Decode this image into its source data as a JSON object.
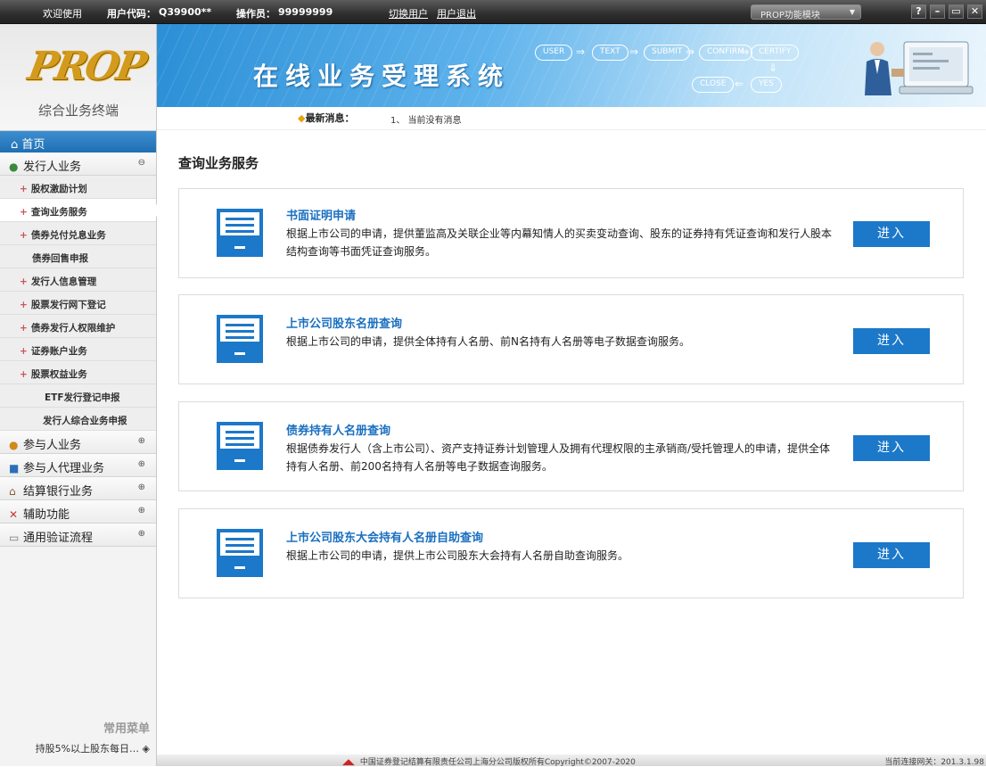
{
  "topbar": {
    "welcome": "欢迎使用",
    "user_code_label": "用户代码：",
    "user_code": "Q39900**",
    "operator_label": "操作员：",
    "operator": "99999999",
    "switch_user": "切换用户",
    "logout": "用户退出",
    "module": "PROP功能模块",
    "win_buttons": [
      "?",
      "–",
      "▭",
      "✕"
    ]
  },
  "sidebar": {
    "logo_word": "PROP",
    "logo_subtitle": "综合业务终端",
    "home": "首页",
    "sections": [
      {
        "label": "发行人业务",
        "icon": "person-icon",
        "toggle": "⊖",
        "expanded": true
      },
      {
        "label": "参与人业务",
        "icon": "people-icon",
        "toggle": "⊕"
      },
      {
        "label": "参与人代理业务",
        "icon": "monitor-icon",
        "toggle": "⊕"
      },
      {
        "label": "结算银行业务",
        "icon": "bank-icon",
        "toggle": "⊕"
      },
      {
        "label": "辅助功能",
        "icon": "tools-icon",
        "toggle": "⊕"
      },
      {
        "label": "通用验证流程",
        "icon": "briefcase-icon",
        "toggle": "⊕"
      }
    ],
    "sub_items": [
      {
        "label": "股权激励计划",
        "plus": true
      },
      {
        "label": "查询业务服务",
        "plus": true,
        "active": true
      },
      {
        "label": "债券兑付兑息业务",
        "plus": true
      },
      {
        "label": "债券回售申报",
        "plus": false
      },
      {
        "label": "发行人信息管理",
        "plus": true
      },
      {
        "label": "股票发行网下登记",
        "plus": true
      },
      {
        "label": "债券发行人权限维护",
        "plus": true
      },
      {
        "label": "证券账户业务",
        "plus": true
      },
      {
        "label": "股票权益业务",
        "plus": true
      },
      {
        "label": "ETF发行登记申报",
        "plus": false
      },
      {
        "label": "发行人综合业务申报",
        "plus": false
      }
    ],
    "common_menu": "常用菜单",
    "favorite": "持股5%以上股东每日… ◈"
  },
  "banner": {
    "title": "在线业务受理系统",
    "flow": [
      "USER",
      "TEXT",
      "SUBMIT",
      "CONFIRM",
      "CERTIFY",
      "CLOSE",
      "YES"
    ]
  },
  "news": {
    "label": "最新消息：",
    "text": "1、 当前没有消息"
  },
  "main": {
    "title": "查询业务服务",
    "cards": [
      {
        "title": "书面证明申请",
        "desc": "根据上市公司的申请，提供董监高及关联企业等内幕知情人的买卖变动查询、股东的证券持有凭证查询和发行人股本结构查询等书面凭证查询服务。",
        "button": "进入"
      },
      {
        "title": "上市公司股东名册查询",
        "desc": "根据上市公司的申请，提供全体持有人名册、前N名持有人名册等电子数据查询服务。",
        "button": "进入"
      },
      {
        "title": "债券持有人名册查询",
        "desc": "根据债券发行人（含上市公司）、资产支持证券计划管理人及拥有代理权限的主承销商/受托管理人的申请，提供全体持有人名册、前200名持有人名册等电子数据查询服务。",
        "button": "进入"
      },
      {
        "title": "上市公司股东大会持有人名册自助查询",
        "desc": "根据上市公司的申请，提供上市公司股东大会持有人名册自助查询服务。",
        "button": "进入"
      }
    ]
  },
  "footer": {
    "copyright": "中国证券登记结算有限责任公司上海分公司版权所有Copyright©2007-2020",
    "gateway": "当前连接网关：201.3.1.98"
  },
  "colors": {
    "accent": "#1c78c9",
    "title_blue": "#1a6fc0",
    "logo_gold": "#d49a1c"
  }
}
